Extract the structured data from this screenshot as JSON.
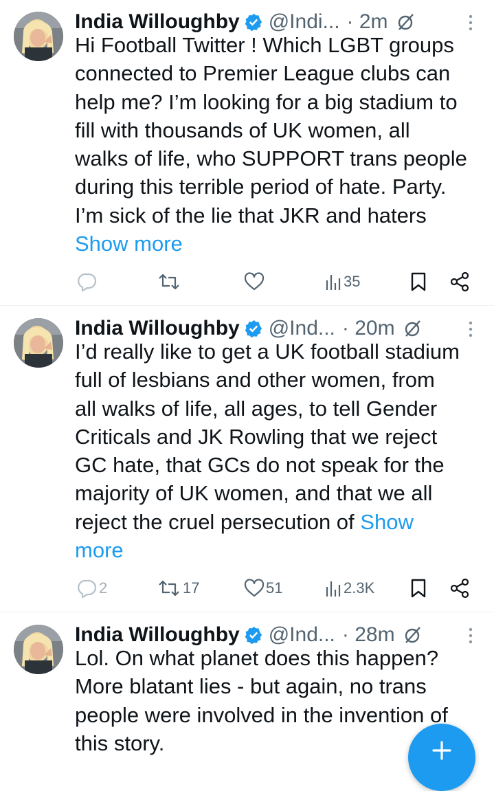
{
  "tweets": [
    {
      "author": "India Willoughby",
      "handle": "@Indi...",
      "time": "· 2m",
      "lines": [
        "Hi Football Twitter ! Which LGBT groups",
        "connected to Premier League clubs can",
        "help me? I’m looking for a big stadium to",
        "fill with thousands of UK women, all",
        "walks of life, who SUPPORT trans people",
        "during this terrible period of hate. Party.",
        "I’m sick of the lie that JKR and haters"
      ],
      "show_more": "Show more",
      "replies": "",
      "retweets": "",
      "likes": "",
      "views": "35"
    },
    {
      "author": "India Willoughby",
      "handle": "@Ind...",
      "time": "· 20m",
      "lines": [
        "I’d really like to get a UK football stadium",
        "full of lesbians and other women, from",
        "all walks of life, all ages, to tell Gender",
        "Criticals and JK Rowling that we reject",
        "GC hate, that GCs do not speak for the",
        "majority of UK women, and that we all",
        "reject the cruel persecution of "
      ],
      "show_more_a": "Show",
      "show_more_b": "more",
      "replies": "2",
      "retweets": "17",
      "likes": "51",
      "views": "2.3K"
    },
    {
      "author": "India Willoughby",
      "handle": "@Ind...",
      "time": "· 28m",
      "lines": [
        "Lol. On what planet does this happen?",
        "More blatant lies - but again, no trans",
        "people were involved in the invention of",
        "this story."
      ]
    }
  ],
  "icons": [
    "verified-badge-icon",
    "mute-icon",
    "more-icon",
    "reply-icon",
    "retweet-icon",
    "like-icon",
    "views-icon",
    "bookmark-icon",
    "share-icon",
    "compose-icon"
  ],
  "colors": {
    "accent": "#1d9bf0",
    "secondary_text": "#536471",
    "text": "#0f1419"
  }
}
